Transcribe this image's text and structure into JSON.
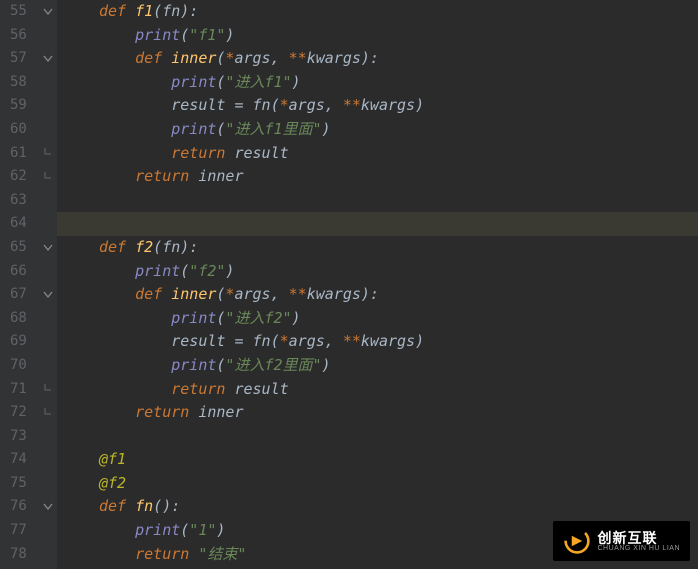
{
  "editor": {
    "cursor_line": 64,
    "lines": [
      {
        "num": 55,
        "fold": "open",
        "indent": 1,
        "tokens": [
          {
            "t": "def ",
            "c": "kw"
          },
          {
            "t": "f1",
            "c": "fname"
          },
          {
            "t": "(",
            "c": "punct"
          },
          {
            "t": "fn",
            "c": "param"
          },
          {
            "t": "):",
            "c": "punct"
          }
        ]
      },
      {
        "num": 56,
        "fold": "",
        "indent": 2,
        "tokens": [
          {
            "t": "print",
            "c": "builtin"
          },
          {
            "t": "(",
            "c": "punct"
          },
          {
            "t": "\"f1\"",
            "c": "str"
          },
          {
            "t": ")",
            "c": "punct"
          }
        ]
      },
      {
        "num": 57,
        "fold": "open",
        "indent": 2,
        "tokens": [
          {
            "t": "def ",
            "c": "kw"
          },
          {
            "t": "inner",
            "c": "fname"
          },
          {
            "t": "(",
            "c": "punct"
          },
          {
            "t": "*",
            "c": "star"
          },
          {
            "t": "args",
            "c": "param"
          },
          {
            "t": ", ",
            "c": "punct"
          },
          {
            "t": "**",
            "c": "star"
          },
          {
            "t": "kwargs",
            "c": "param"
          },
          {
            "t": "):",
            "c": "punct"
          }
        ]
      },
      {
        "num": 58,
        "fold": "",
        "indent": 3,
        "tokens": [
          {
            "t": "print",
            "c": "builtin"
          },
          {
            "t": "(",
            "c": "punct"
          },
          {
            "t": "\"进入f1\"",
            "c": "str"
          },
          {
            "t": ")",
            "c": "punct"
          }
        ]
      },
      {
        "num": 59,
        "fold": "",
        "indent": 3,
        "tokens": [
          {
            "t": "result = fn(",
            "c": "param"
          },
          {
            "t": "*",
            "c": "star"
          },
          {
            "t": "args",
            "c": "param"
          },
          {
            "t": ", ",
            "c": "punct"
          },
          {
            "t": "**",
            "c": "star"
          },
          {
            "t": "kwargs",
            "c": "param"
          },
          {
            "t": ")",
            "c": "punct"
          }
        ]
      },
      {
        "num": 60,
        "fold": "",
        "indent": 3,
        "tokens": [
          {
            "t": "print",
            "c": "builtin"
          },
          {
            "t": "(",
            "c": "punct"
          },
          {
            "t": "\"进入f1里面\"",
            "c": "str"
          },
          {
            "t": ")",
            "c": "punct"
          }
        ]
      },
      {
        "num": 61,
        "fold": "end",
        "indent": 3,
        "tokens": [
          {
            "t": "return ",
            "c": "kw"
          },
          {
            "t": "result",
            "c": "param"
          }
        ]
      },
      {
        "num": 62,
        "fold": "end",
        "indent": 2,
        "tokens": [
          {
            "t": "return ",
            "c": "kw"
          },
          {
            "t": "inner",
            "c": "param"
          }
        ]
      },
      {
        "num": 63,
        "fold": "",
        "indent": 0,
        "tokens": []
      },
      {
        "num": 64,
        "fold": "",
        "indent": 0,
        "tokens": []
      },
      {
        "num": 65,
        "fold": "open",
        "indent": 1,
        "tokens": [
          {
            "t": "def ",
            "c": "kw"
          },
          {
            "t": "f2",
            "c": "fname"
          },
          {
            "t": "(",
            "c": "punct"
          },
          {
            "t": "fn",
            "c": "param"
          },
          {
            "t": "):",
            "c": "punct"
          }
        ]
      },
      {
        "num": 66,
        "fold": "",
        "indent": 2,
        "tokens": [
          {
            "t": "print",
            "c": "builtin"
          },
          {
            "t": "(",
            "c": "punct"
          },
          {
            "t": "\"f2\"",
            "c": "str"
          },
          {
            "t": ")",
            "c": "punct"
          }
        ]
      },
      {
        "num": 67,
        "fold": "open",
        "indent": 2,
        "tokens": [
          {
            "t": "def ",
            "c": "kw"
          },
          {
            "t": "inner",
            "c": "fname"
          },
          {
            "t": "(",
            "c": "punct"
          },
          {
            "t": "*",
            "c": "star"
          },
          {
            "t": "args",
            "c": "param"
          },
          {
            "t": ", ",
            "c": "punct"
          },
          {
            "t": "**",
            "c": "star"
          },
          {
            "t": "kwargs",
            "c": "param"
          },
          {
            "t": "):",
            "c": "punct"
          }
        ]
      },
      {
        "num": 68,
        "fold": "",
        "indent": 3,
        "tokens": [
          {
            "t": "print",
            "c": "builtin"
          },
          {
            "t": "(",
            "c": "punct"
          },
          {
            "t": "\"进入f2\"",
            "c": "str"
          },
          {
            "t": ")",
            "c": "punct"
          }
        ]
      },
      {
        "num": 69,
        "fold": "",
        "indent": 3,
        "tokens": [
          {
            "t": "result = fn(",
            "c": "param"
          },
          {
            "t": "*",
            "c": "star"
          },
          {
            "t": "args",
            "c": "param"
          },
          {
            "t": ", ",
            "c": "punct"
          },
          {
            "t": "**",
            "c": "star"
          },
          {
            "t": "kwargs",
            "c": "param"
          },
          {
            "t": ")",
            "c": "punct"
          }
        ]
      },
      {
        "num": 70,
        "fold": "",
        "indent": 3,
        "tokens": [
          {
            "t": "print",
            "c": "builtin"
          },
          {
            "t": "(",
            "c": "punct"
          },
          {
            "t": "\"进入f2里面\"",
            "c": "str"
          },
          {
            "t": ")",
            "c": "punct"
          }
        ]
      },
      {
        "num": 71,
        "fold": "end",
        "indent": 3,
        "tokens": [
          {
            "t": "return ",
            "c": "kw"
          },
          {
            "t": "result",
            "c": "param"
          }
        ]
      },
      {
        "num": 72,
        "fold": "end",
        "indent": 2,
        "tokens": [
          {
            "t": "return ",
            "c": "kw"
          },
          {
            "t": "inner",
            "c": "param"
          }
        ]
      },
      {
        "num": 73,
        "fold": "",
        "indent": 0,
        "tokens": []
      },
      {
        "num": 74,
        "fold": "",
        "indent": 1,
        "tokens": [
          {
            "t": "@f1",
            "c": "deco"
          }
        ]
      },
      {
        "num": 75,
        "fold": "",
        "indent": 1,
        "tokens": [
          {
            "t": "@f2",
            "c": "deco"
          }
        ]
      },
      {
        "num": 76,
        "fold": "open",
        "indent": 1,
        "tokens": [
          {
            "t": "def ",
            "c": "kw"
          },
          {
            "t": "fn",
            "c": "fname"
          },
          {
            "t": "():",
            "c": "punct"
          }
        ]
      },
      {
        "num": 77,
        "fold": "",
        "indent": 2,
        "tokens": [
          {
            "t": "print",
            "c": "builtin"
          },
          {
            "t": "(",
            "c": "punct"
          },
          {
            "t": "\"1\"",
            "c": "str"
          },
          {
            "t": ")",
            "c": "punct"
          }
        ]
      },
      {
        "num": 78,
        "fold": "",
        "indent": 2,
        "tokens": [
          {
            "t": "return ",
            "c": "kw"
          },
          {
            "t": "\"结束\"",
            "c": "str"
          }
        ]
      }
    ]
  },
  "logo": {
    "main": "创新互联",
    "sub": "CHUANG XIN HU LIAN"
  }
}
